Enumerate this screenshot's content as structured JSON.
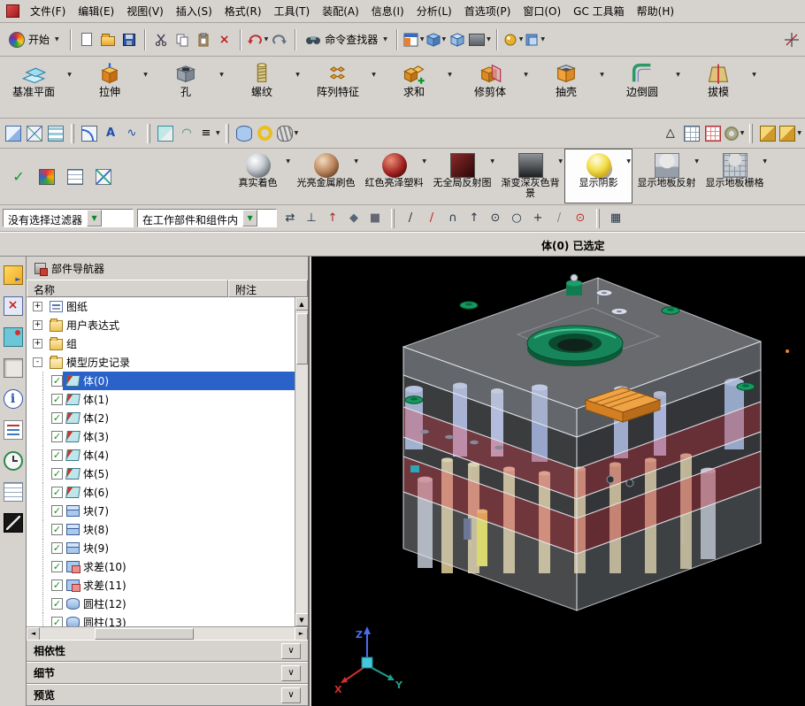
{
  "menu": {
    "items": [
      "文件(F)",
      "编辑(E)",
      "视图(V)",
      "插入(S)",
      "格式(R)",
      "工具(T)",
      "装配(A)",
      "信息(I)",
      "分析(L)",
      "首选项(P)",
      "窗口(O)",
      "GC 工具箱",
      "帮助(H)"
    ]
  },
  "standard_toolbar": {
    "start_label": "开始",
    "command_finder_label": "命令查找器"
  },
  "feature_toolbar": {
    "buttons": [
      {
        "label": "基准平面",
        "icon": "datum-plane"
      },
      {
        "label": "拉伸",
        "icon": "extrude"
      },
      {
        "label": "孔",
        "icon": "hole"
      },
      {
        "label": "螺纹",
        "icon": "thread"
      },
      {
        "label": "阵列特征",
        "icon": "pattern"
      },
      {
        "label": "求和",
        "icon": "unite"
      },
      {
        "label": "修剪体",
        "icon": "trim-body"
      },
      {
        "label": "抽壳",
        "icon": "shell"
      },
      {
        "label": "边倒圆",
        "icon": "edge-blend"
      },
      {
        "label": "拔模",
        "icon": "draft"
      }
    ]
  },
  "render_toolbar": {
    "buttons": [
      {
        "label": "真实着色",
        "icon": "sphere-silver",
        "active": false
      },
      {
        "label": "光亮金属刷色",
        "icon": "sphere-bronze",
        "active": false
      },
      {
        "label": "红色亮泽塑料",
        "icon": "sphere-red",
        "active": false
      },
      {
        "label": "无全局反射图",
        "icon": "square-darkred",
        "active": false
      },
      {
        "label": "渐变深灰色背景",
        "icon": "square-gradient",
        "active": false
      },
      {
        "label": "显示阴影",
        "icon": "shadow",
        "active": true
      },
      {
        "label": "显示地板反射",
        "icon": "floor-reflection",
        "active": false
      },
      {
        "label": "显示地板栅格",
        "icon": "floor-grid",
        "active": false
      }
    ]
  },
  "selection_bar": {
    "filter_value": "没有选择过滤器",
    "scope_value": "在工作部件和组件内",
    "buttons": [
      "swap",
      "anchor",
      "arrow-up",
      "plane",
      "cube",
      "|",
      "line",
      "line-red",
      "arc",
      "arrow",
      "center",
      "circle",
      "plus",
      "slash",
      "point-red",
      "|",
      "grid"
    ]
  },
  "status_bar": {
    "text": "体(0) 已选定"
  },
  "resource_bar": {
    "icons": [
      "assembly-navigator",
      "constraint-navigator",
      "reuse-library",
      "part-navigator",
      "information",
      "document",
      "history",
      "notes",
      "roles"
    ],
    "active": "part-navigator"
  },
  "navigator": {
    "title": "部件导航器",
    "columns": {
      "name": "名称",
      "note": "附注"
    },
    "tree": [
      {
        "label": "图纸",
        "icon": "drawing",
        "expander": "+",
        "level": 0
      },
      {
        "label": "用户表达式",
        "icon": "folder",
        "expander": "+",
        "level": 0
      },
      {
        "label": "组",
        "icon": "folder",
        "expander": "+",
        "level": 0
      },
      {
        "label": "模型历史记录",
        "icon": "folder-open",
        "expander": "-",
        "level": 0
      },
      {
        "label": "体(0)",
        "icon": "body",
        "checked": true,
        "selected": true,
        "level": 1
      },
      {
        "label": "体(1)",
        "icon": "body",
        "checked": true,
        "level": 1
      },
      {
        "label": "体(2)",
        "icon": "body",
        "checked": true,
        "level": 1
      },
      {
        "label": "体(3)",
        "icon": "body",
        "checked": true,
        "level": 1
      },
      {
        "label": "体(4)",
        "icon": "body",
        "checked": true,
        "level": 1
      },
      {
        "label": "体(5)",
        "icon": "body",
        "checked": true,
        "level": 1
      },
      {
        "label": "体(6)",
        "icon": "body",
        "checked": true,
        "level": 1
      },
      {
        "label": "块(7)",
        "icon": "block",
        "checked": true,
        "level": 1
      },
      {
        "label": "块(8)",
        "icon": "block",
        "checked": true,
        "level": 1
      },
      {
        "label": "块(9)",
        "icon": "block",
        "checked": true,
        "level": 1
      },
      {
        "label": "求差(10)",
        "icon": "subtract",
        "checked": true,
        "level": 1
      },
      {
        "label": "求差(11)",
        "icon": "subtract",
        "checked": true,
        "level": 1
      },
      {
        "label": "圆柱(12)",
        "icon": "cylinder",
        "checked": true,
        "level": 1
      },
      {
        "label": "圆柱(13)",
        "icon": "cylinder",
        "checked": true,
        "level": 1
      }
    ],
    "sections": [
      "相依性",
      "细节",
      "预览"
    ]
  },
  "viewport": {
    "triad": {
      "x": "X",
      "y": "Y",
      "z": "Z"
    }
  }
}
